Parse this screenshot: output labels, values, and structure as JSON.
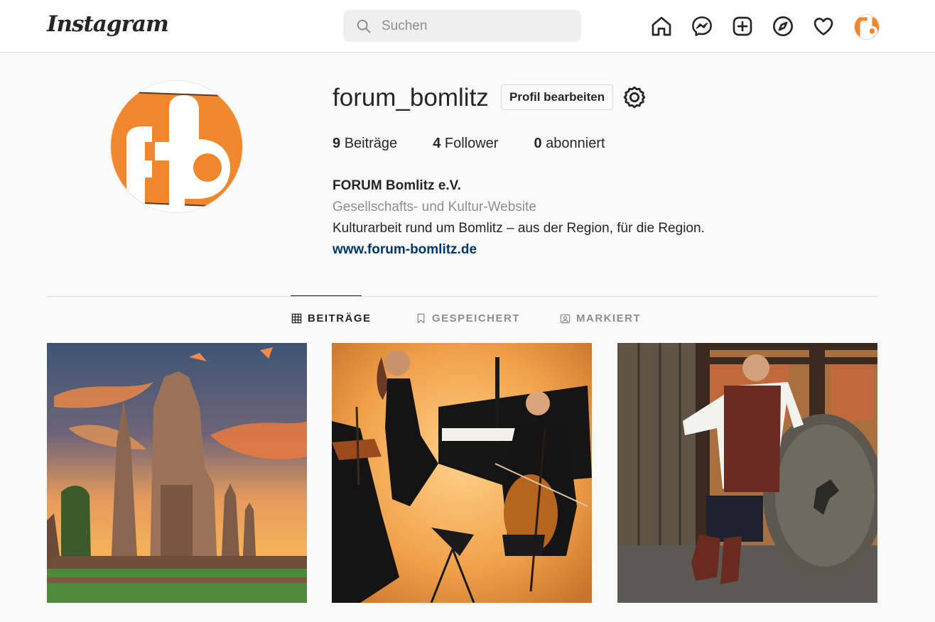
{
  "nav": {
    "logo": "Instagram",
    "search_placeholder": "Suchen",
    "icons": [
      "home-icon",
      "messenger-icon",
      "new-post-icon",
      "explore-icon",
      "activity-heart-icon",
      "profile-avatar"
    ]
  },
  "profile": {
    "username": "forum_bomlitz",
    "edit_label": "Profil bearbeiten",
    "stats": [
      {
        "count": "9",
        "label": "Beiträge"
      },
      {
        "count": "4",
        "label": "Follower"
      },
      {
        "count": "0",
        "label": "abonniert"
      }
    ],
    "bio": {
      "name": "FORUM Bomlitz e.V.",
      "category": "Gesellschafts- und Kultur-Website",
      "text": "Kulturarbeit rund um Bomlitz – aus der Region, für die Region.",
      "link": "www.forum-bomlitz.de"
    }
  },
  "tabs": [
    {
      "label": "BEITRÄGE",
      "icon": "grid-icon",
      "active": true
    },
    {
      "label": "GESPEICHERT",
      "icon": "bookmark-icon",
      "active": false
    },
    {
      "label": "MARKIERT",
      "icon": "tagged-person-icon",
      "active": false
    }
  ],
  "colors": {
    "accent_orange": "#f0872a",
    "link_blue": "#00376b",
    "text": "#262626",
    "muted": "#8e8e8e",
    "border": "#dbdbdb"
  },
  "posts": [
    {
      "subject": "temple-sunset"
    },
    {
      "subject": "piano-trio-concert"
    },
    {
      "subject": "man-medieval-costume-millstone"
    }
  ]
}
